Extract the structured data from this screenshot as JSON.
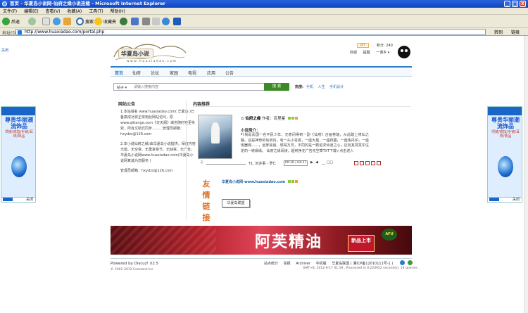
{
  "window": {
    "title": "首页 - 华夏岛小说网-仙府之缘小说连载 - Microsoft Internet Explorer",
    "buttons": [
      "_",
      "□",
      "X"
    ]
  },
  "menu": [
    "文件(F)",
    "编辑(E)",
    "查看(V)",
    "收藏(A)",
    "工具(T)",
    "帮助(H)"
  ],
  "toolbar": {
    "back": "后退",
    "search": "搜索",
    "favorites": "收藏夹"
  },
  "address": {
    "label": "地址(D)",
    "url": "http://www.huaxiadao.com/portal.php",
    "go": "转到",
    "links": "链接"
  },
  "site": {
    "logo_text": "华夏岛小说",
    "logo_url": "w w w . h u a x i a d a o . c o m",
    "close_left": "关闭",
    "diy": "DIY",
    "score": "积分: 240",
    "user_links": [
      "商城",
      "提醒",
      "一课乡 ▾"
    ],
    "nav": [
      "首页",
      "仙府",
      "论坛",
      "家园",
      "电视",
      "应用",
      "公告"
    ],
    "search": {
      "scope": "帖子 ▾",
      "placeholder": "请输入搜索内容",
      "button": "搜 索",
      "hot_label": "热搜:",
      "hot_words": [
        "手机",
        "人生",
        "手机设计"
      ]
    },
    "notice": {
      "title": "网站公告",
      "body": [
        "1.本站域名 www.huaxiadao.com( 华夏岛 )已备案成功将正常用此网站访问，原www.qitiange.com《天天阁》域名随时变更失效，所有文助式同步………管理员邮箱：hxydzs@126.com",
        "2.本小说仙府之缘)由华夏岛小说提供，保证内容无错、无空章、无重复章节、无缺章、无广告。华夏岛小说网www.huaxiadao.com(华夏岛小说网真诚为您服务 )",
        "管理员邮箱：hxydzs@126.com"
      ]
    },
    "recommend": {
      "title": "内容推荐",
      "book_title": "仙府之缘",
      "author_label": "作者：",
      "author": "百里鉴",
      "intro_label": "小说简介：",
      "intro": "叶易是武国一名平民少年，无意间得到一副《仙府》古画卷轴，从此踏上修仙之路。这是神奇的仙府内，有一头小青狐，一座大屋，一座药圃，一座炼丹炉，一座炼器阁……，运筹易良，想得万灵，不同的是一颗追求仙道之心，还有其冥冥中注定的一统缘缘。 仙府之缘阅读，超纯净无广告无空章TXT下载>点击进入",
      "player_track": "T1. 刘亦事 - 罗仁",
      "player_time": "00:18 | 04:37"
    },
    "links": {
      "title_chars": [
        "友",
        "情",
        "链",
        "接"
      ],
      "site_link": "华夏岛小说网-www.huaxiadao.com",
      "friend_button": "华夏岛联盟"
    },
    "banner": {
      "main_text": "阿芙精油",
      "new_text": "新品上市",
      "afu": "AFU"
    },
    "footer": {
      "powered": "Powered by Discuz! X2.5",
      "copyright": "© 2001-2012 Comsenz Inc.",
      "links": [
        "站点统计",
        "举报",
        "Archiver",
        "手机版",
        "华夏岛联盟 ( 湘ICP备12010111号-1 )"
      ],
      "info": "GMT+8, 2012-6-17 01:19 , Processed in 0.220952 second(s), 14 queries ."
    },
    "side_ads": {
      "title": "尊贵华丽潮流饰品",
      "sub": "项链/戒指/手链/耳饰/饰品",
      "close": "关闭"
    }
  }
}
